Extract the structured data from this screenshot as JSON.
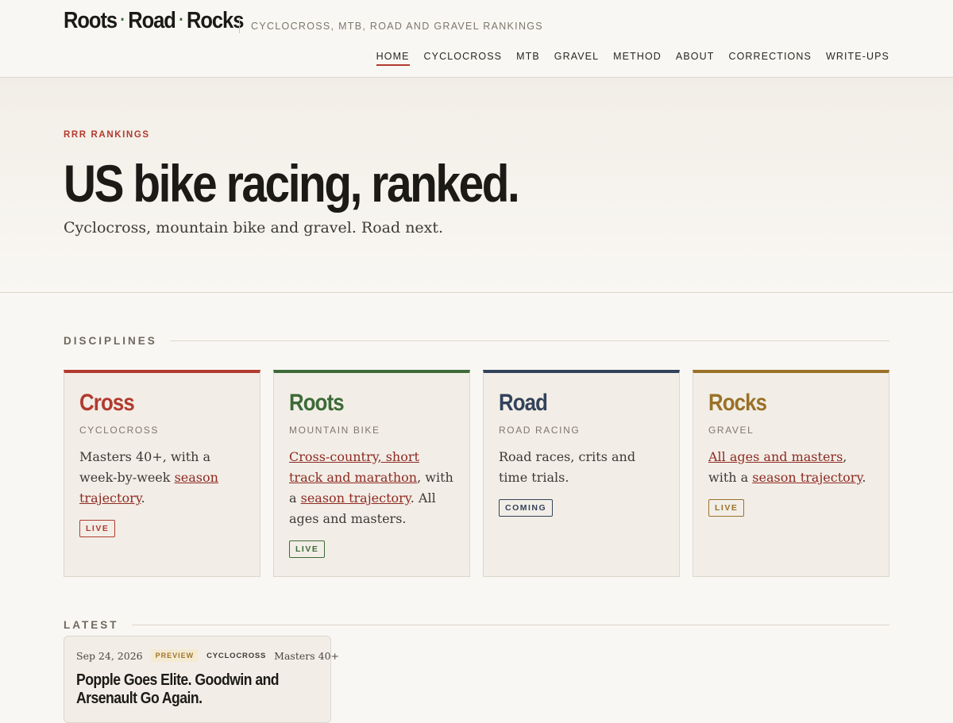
{
  "brand": {
    "part1": "Roots",
    "sep": "·",
    "part2": "Road",
    "part3": "Rocks"
  },
  "tagline": "CYCLOCROSS, MTB, ROAD AND GRAVEL RANKINGS",
  "nav": {
    "items": [
      "HOME",
      "CYCLOCROSS",
      "MTB",
      "GRAVEL",
      "METHOD",
      "ABOUT",
      "CORRECTIONS",
      "WRITE-UPS"
    ],
    "active": "HOME"
  },
  "hero": {
    "eyebrow": "RRR RANKINGS",
    "title": "US bike racing, ranked.",
    "subtitle": "Cyclocross, mountain bike and gravel. Road next."
  },
  "disciplines": {
    "label": "DISCIPLINES",
    "cards": [
      {
        "title": "Cross",
        "subtitle": "CYCLOCROSS",
        "color": "#b23a2f",
        "desc": {
          "pre": "Masters 40+, with a week-by-week ",
          "link": "season trajectory",
          "mid": ".",
          "link2": "",
          "post": ""
        },
        "badge": "LIVE"
      },
      {
        "title": "Roots",
        "subtitle": "MOUNTAIN BIKE",
        "color": "#3c6a37",
        "desc": {
          "pre": "",
          "link": "Cross-country, short track and marathon",
          "mid": ", with a ",
          "link2": "season trajectory",
          "post": ". All ages and masters."
        },
        "badge": "LIVE"
      },
      {
        "title": "Road",
        "subtitle": "ROAD RACING",
        "color": "#33425a",
        "desc": {
          "pre": "Road races, crits and time trials.",
          "link": "",
          "mid": "",
          "link2": "",
          "post": ""
        },
        "badge": "COMING"
      },
      {
        "title": "Rocks",
        "subtitle": "GRAVEL",
        "color": "#9a7128",
        "desc": {
          "pre": "",
          "link": "All ages and masters",
          "mid": ", with a ",
          "link2": "season trajectory",
          "post": "."
        },
        "badge": "LIVE"
      }
    ]
  },
  "latest": {
    "label": "LATEST",
    "posts": [
      {
        "date": "Sep 24, 2026",
        "tag": "PREVIEW",
        "discipline": "CYCLOCROSS",
        "category": "Masters 40+",
        "title": "Popple Goes Elite. Goodwin and Arsenault Go Again."
      }
    ]
  }
}
